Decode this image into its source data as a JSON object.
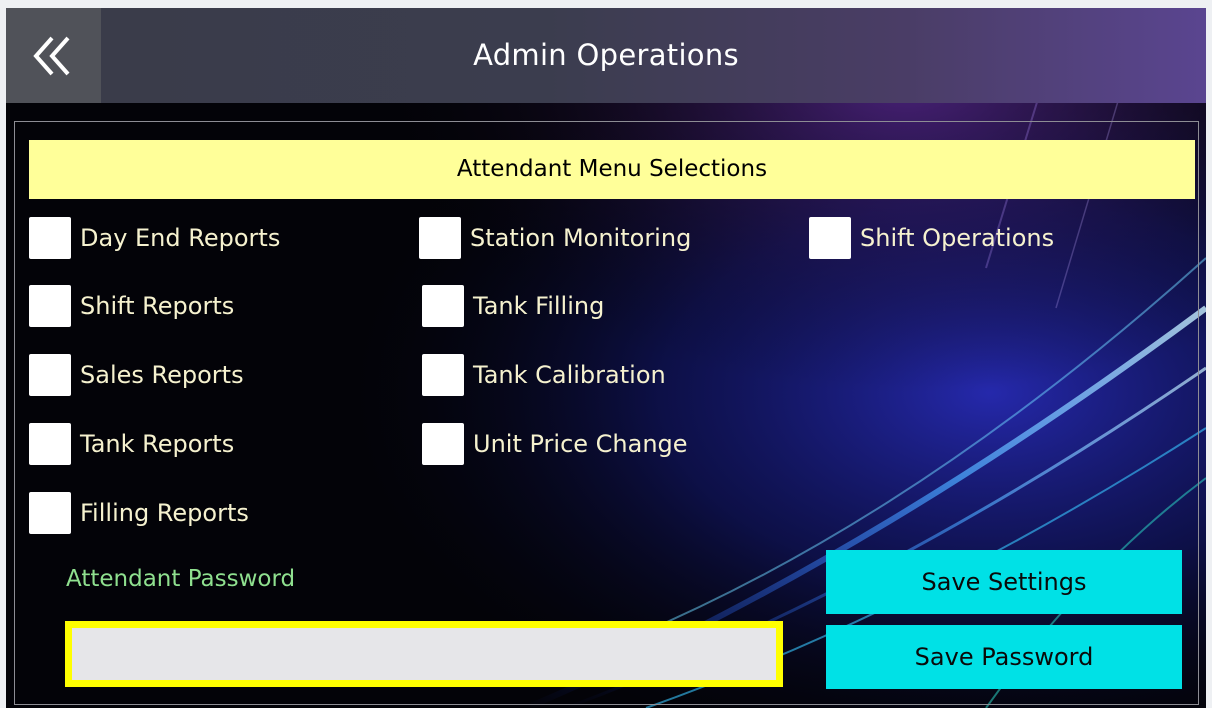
{
  "header": {
    "title": "Admin Operations",
    "back_icon": "double-chevron-left-icon"
  },
  "section": {
    "title": "Attendant Menu Selections"
  },
  "options": [
    {
      "label": "Day End Reports",
      "checked": false
    },
    {
      "label": "Shift Reports",
      "checked": false
    },
    {
      "label": "Sales Reports",
      "checked": false
    },
    {
      "label": "Tank Reports",
      "checked": false
    },
    {
      "label": "Filling Reports",
      "checked": false
    },
    {
      "label": "Station Monitoring",
      "checked": false
    },
    {
      "label": "Tank Filling",
      "checked": false
    },
    {
      "label": "Tank Calibration",
      "checked": false
    },
    {
      "label": "Unit Price Change",
      "checked": false
    },
    {
      "label": "Shift Operations",
      "checked": false
    }
  ],
  "password": {
    "label": "Attendant Password",
    "value": "",
    "placeholder": ""
  },
  "buttons": {
    "save_settings": "Save Settings",
    "save_password": "Save Password"
  },
  "colors": {
    "section_header_bg": "#ffff99",
    "option_text": "#f6f2cf",
    "password_label": "#8fe08f",
    "password_border": "#ffff00",
    "button_bg": "#00e1e6"
  }
}
